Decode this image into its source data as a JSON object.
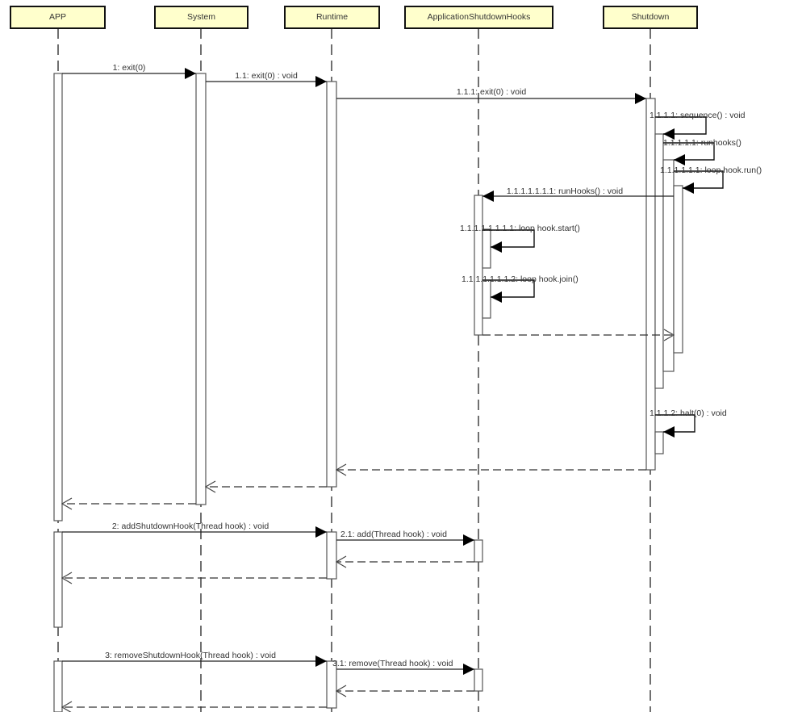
{
  "participants": [
    "APP",
    "System",
    "Runtime",
    "ApplicationShutdownHooks",
    "Shutdown"
  ],
  "messages": [
    {
      "id": "m1",
      "label": "1: exit(0)",
      "kind": "call"
    },
    {
      "id": "m1_1",
      "label": "1.1: exit(0) : void",
      "kind": "call"
    },
    {
      "id": "m1_1_1",
      "label": "1.1.1: exit(0) : void",
      "kind": "call"
    },
    {
      "id": "m1_1_1_1",
      "label": "1.1.1.1: sequence() : void",
      "kind": "self"
    },
    {
      "id": "m1_1_1_1_1",
      "label": "1.1.1.1.1: runhooks()",
      "kind": "self"
    },
    {
      "id": "m1_1_1_1_1_1",
      "label": "1.1.1.1.1.1: loop.hook.run()",
      "kind": "self"
    },
    {
      "id": "m_runhooks",
      "label": "1.1.1.1.1.1.1: runHooks() : void",
      "kind": "call"
    },
    {
      "id": "m_start",
      "label": "1.1.1.1.1.1.1.1: loop hook.start()",
      "kind": "self"
    },
    {
      "id": "m_join",
      "label": "1.1.1.1.1.1.1.2: loop hook.join()",
      "kind": "self"
    },
    {
      "id": "r_runhooks",
      "label": "",
      "kind": "return"
    },
    {
      "id": "m_halt",
      "label": "1.1.1.2: halt(0) : void",
      "kind": "self"
    },
    {
      "id": "r1_1_1",
      "label": "",
      "kind": "return"
    },
    {
      "id": "r1_1",
      "label": "",
      "kind": "return"
    },
    {
      "id": "r1",
      "label": "",
      "kind": "return"
    },
    {
      "id": "m2",
      "label": "2: addShutdownHook(Thread hook) : void",
      "kind": "call"
    },
    {
      "id": "m2_1",
      "label": "2.1: add(Thread hook) : void",
      "kind": "call"
    },
    {
      "id": "r2_1",
      "label": "",
      "kind": "return"
    },
    {
      "id": "r2",
      "label": "",
      "kind": "return"
    },
    {
      "id": "m3",
      "label": "3: removeShutdownHook(Thread hook) : void",
      "kind": "call"
    },
    {
      "id": "m3_1",
      "label": "3.1: remove(Thread hook) : void",
      "kind": "call"
    },
    {
      "id": "r3_1",
      "label": "",
      "kind": "return"
    },
    {
      "id": "r3",
      "label": "",
      "kind": "return"
    }
  ],
  "colors": {
    "participant_fill": "#ffffcc",
    "line": "#000000",
    "text": "#333333"
  }
}
